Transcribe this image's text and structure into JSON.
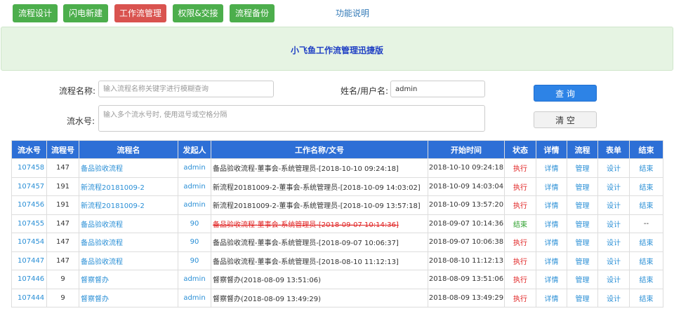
{
  "nav": {
    "buttons": [
      {
        "label": "流程设计",
        "color": "#4cae4c"
      },
      {
        "label": "闪电新建",
        "color": "#4cae4c"
      },
      {
        "label": "工作流管理",
        "color": "#d9534f"
      },
      {
        "label": "权限&交接",
        "color": "#4cae4c"
      },
      {
        "label": "流程备份",
        "color": "#4cae4c"
      }
    ],
    "help_link": "功能说明"
  },
  "banner": {
    "title": "小飞鱼工作流管理迅捷版"
  },
  "search": {
    "flow_name_label": "流程名称:",
    "flow_name_placeholder": "输入流程名称关键字进行模糊查询",
    "user_label": "姓名/用户名:",
    "user_value": "admin",
    "serial_label": "流水号:",
    "serial_placeholder": "输入多个流水号时, 使用逗号或空格分隔",
    "query_button": "查 询",
    "clear_button": "清 空"
  },
  "table": {
    "headers": [
      "流水号",
      "流程号",
      "流程名",
      "发起人",
      "工作名称/文号",
      "开始时间",
      "状态",
      "详情",
      "流程",
      "表单",
      "结束"
    ],
    "rows": [
      {
        "serial": "107458",
        "flow_no": "147",
        "flow_name": "备品验收流程",
        "initiator": "admin",
        "work_name": "备品验收流程-董事会-系统管理员-[2018-10-10 09:24:18]",
        "start_time": "2018-10-10 09:24:18",
        "status": "执行",
        "detail": "详情",
        "manage": "管理",
        "form": "设计",
        "end": "结束"
      },
      {
        "serial": "107457",
        "flow_no": "191",
        "flow_name": "新流程20181009-2",
        "initiator": "admin",
        "work_name": "新流程20181009-2-董事会-系统管理员-[2018-10-09 14:03:02]",
        "start_time": "2018-10-09 14:03:04",
        "status": "执行",
        "detail": "详情",
        "manage": "管理",
        "form": "设计",
        "end": "结束"
      },
      {
        "serial": "107456",
        "flow_no": "191",
        "flow_name": "新流程20181009-2",
        "initiator": "admin",
        "work_name": "新流程20181009-2-董事会-系统管理员-[2018-10-09 13:57:18]",
        "start_time": "2018-10-09 13:57:20",
        "status": "执行",
        "detail": "详情",
        "manage": "管理",
        "form": "设计",
        "end": "结束"
      },
      {
        "serial": "107455",
        "flow_no": "147",
        "flow_name": "备品验收流程",
        "initiator": "90",
        "work_name": "备品验收流程-董事会-系统管理员-[2018-09-07 10:14:36]",
        "start_time": "2018-09-07 10:14:36",
        "status": "结束",
        "detail": "详情",
        "manage": "管理",
        "form": "设计",
        "end": "--",
        "finished": true
      },
      {
        "serial": "107454",
        "flow_no": "147",
        "flow_name": "备品验收流程",
        "initiator": "90",
        "work_name": "备品验收流程-董事会-系统管理员-[2018-09-07 10:06:37]",
        "start_time": "2018-09-07 10:06:38",
        "status": "执行",
        "detail": "详情",
        "manage": "管理",
        "form": "设计",
        "end": "结束"
      },
      {
        "serial": "107447",
        "flow_no": "147",
        "flow_name": "备品验收流程",
        "initiator": "90",
        "work_name": "备品验收流程-董事会-系统管理员-[2018-08-10 11:12:13]",
        "start_time": "2018-08-10 11:12:13",
        "status": "执行",
        "detail": "详情",
        "manage": "管理",
        "form": "设计",
        "end": "结束"
      },
      {
        "serial": "107446",
        "flow_no": "9",
        "flow_name": "督察督办",
        "initiator": "admin",
        "work_name": "督察督办(2018-08-09 13:51:06)",
        "start_time": "2018-08-09 13:51:06",
        "status": "执行",
        "detail": "详情",
        "manage": "管理",
        "form": "设计",
        "end": "结束"
      },
      {
        "serial": "107444",
        "flow_no": "9",
        "flow_name": "督察督办",
        "initiator": "admin",
        "work_name": "督察督办(2018-08-09 13:49:29)",
        "start_time": "2018-08-09 13:49:29",
        "status": "执行",
        "detail": "详情",
        "manage": "管理",
        "form": "设计",
        "end": "结束"
      }
    ]
  }
}
